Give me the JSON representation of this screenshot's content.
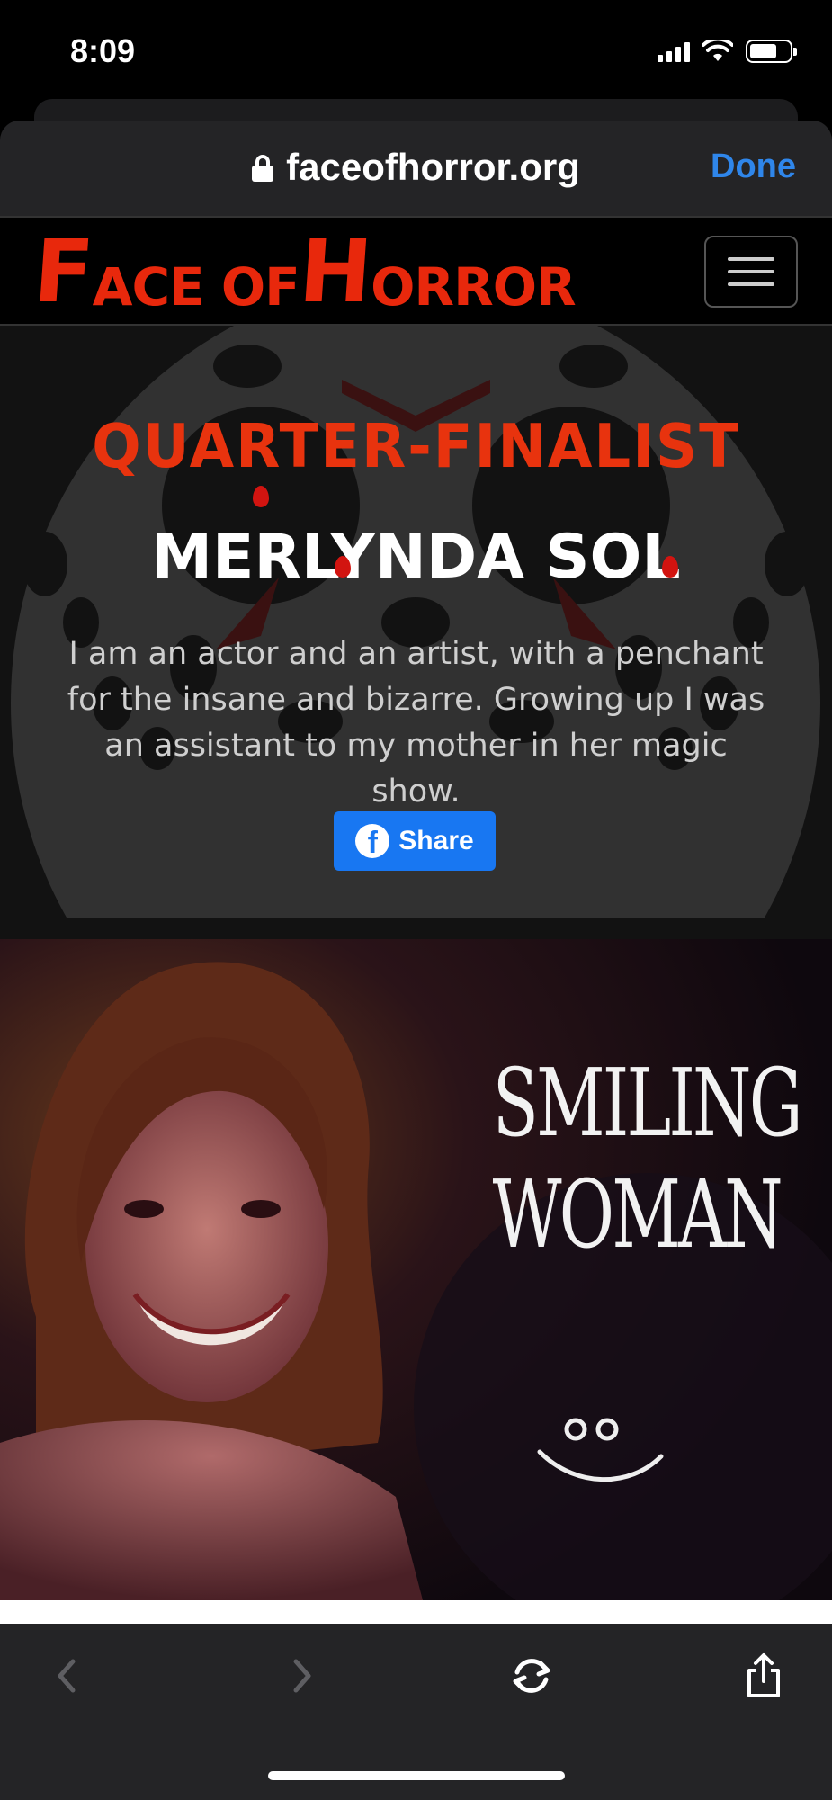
{
  "status_bar": {
    "time": "8:09"
  },
  "browser": {
    "url": "faceofhorror.org",
    "done_label": "Done"
  },
  "site": {
    "logo": {
      "part1_big": "F",
      "part1_small": "ACE OF",
      "part2_big": "H",
      "part2_small": "ORROR"
    }
  },
  "hero": {
    "rank": "QUARTER-FINALIST",
    "name": "MERLYNDA SOL",
    "bio": "I am an actor and an artist, with a penchant for the insane and bizarre. Growing up I was an assistant to my mother in her magic show.",
    "share_label": "Share"
  },
  "feature_image": {
    "title_line1": "SMILING",
    "title_line2": "WOMAN"
  },
  "colors": {
    "brand_red": "#e8280c",
    "link_blue": "#2f86ea",
    "facebook_blue": "#1877f2"
  },
  "icons": [
    "lock-icon",
    "hamburger-icon",
    "facebook-icon",
    "back-icon",
    "forward-icon",
    "reload-icon",
    "share-icon"
  ]
}
